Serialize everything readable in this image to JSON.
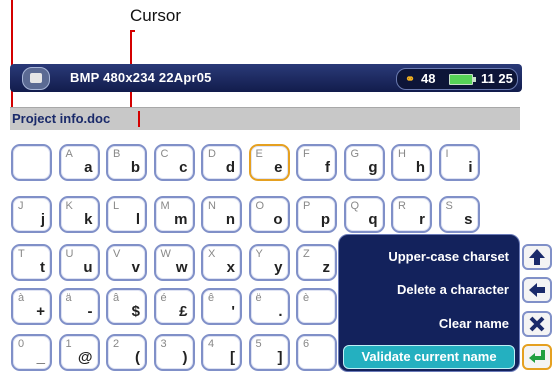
{
  "callout": {
    "label": "Cursor"
  },
  "header": {
    "title": "BMP 480x234 22Apr05",
    "volume": "48",
    "time": "11 25"
  },
  "name_field": {
    "value": "Project info.doc"
  },
  "keyboard": {
    "rows": [
      [
        [
          "",
          ""
        ],
        [
          "A",
          "a"
        ],
        [
          "B",
          "b"
        ],
        [
          "C",
          "c"
        ],
        [
          "D",
          "d"
        ],
        [
          "E",
          "e"
        ],
        [
          "F",
          "f"
        ],
        [
          "G",
          "g"
        ],
        [
          "H",
          "h"
        ],
        [
          "I",
          "i"
        ]
      ],
      [
        [
          "J",
          "j"
        ],
        [
          "K",
          "k"
        ],
        [
          "L",
          "l"
        ],
        [
          "M",
          "m"
        ],
        [
          "N",
          "n"
        ],
        [
          "O",
          "o"
        ],
        [
          "P",
          "p"
        ],
        [
          "Q",
          "q"
        ],
        [
          "R",
          "r"
        ],
        [
          "S",
          "s"
        ]
      ],
      [
        [
          "T",
          "t"
        ],
        [
          "U",
          "u"
        ],
        [
          "V",
          "v"
        ],
        [
          "W",
          "w"
        ],
        [
          "X",
          "x"
        ],
        [
          "Y",
          "y"
        ],
        [
          "Z",
          "z"
        ]
      ],
      [
        [
          "à",
          "+"
        ],
        [
          "ä",
          "-"
        ],
        [
          "â",
          "$"
        ],
        [
          "é",
          "£"
        ],
        [
          "ê",
          "'"
        ],
        [
          "ë",
          "."
        ],
        [
          "è",
          ""
        ]
      ],
      [
        [
          "0",
          "_"
        ],
        [
          "1",
          "@"
        ],
        [
          "2",
          "("
        ],
        [
          "3",
          ")"
        ],
        [
          "4",
          "["
        ],
        [
          "5",
          "]"
        ],
        [
          "6",
          ""
        ]
      ]
    ],
    "selected_key": "e"
  },
  "menu": {
    "items": [
      {
        "label": "Upper-case charset",
        "icon": "arrow-up-icon"
      },
      {
        "label": "Delete a character",
        "icon": "arrow-left-icon"
      },
      {
        "label": "Clear name",
        "icon": "close-icon"
      },
      {
        "label": "Validate current name",
        "icon": "enter-icon",
        "highlighted": true
      }
    ]
  },
  "colors": {
    "header": "#1a2660",
    "menu_bg": "#13225c",
    "highlight": "#24b0c0",
    "key_border": "#8090c8",
    "key_selected": "#e5a020",
    "cursor": "#d40000"
  }
}
